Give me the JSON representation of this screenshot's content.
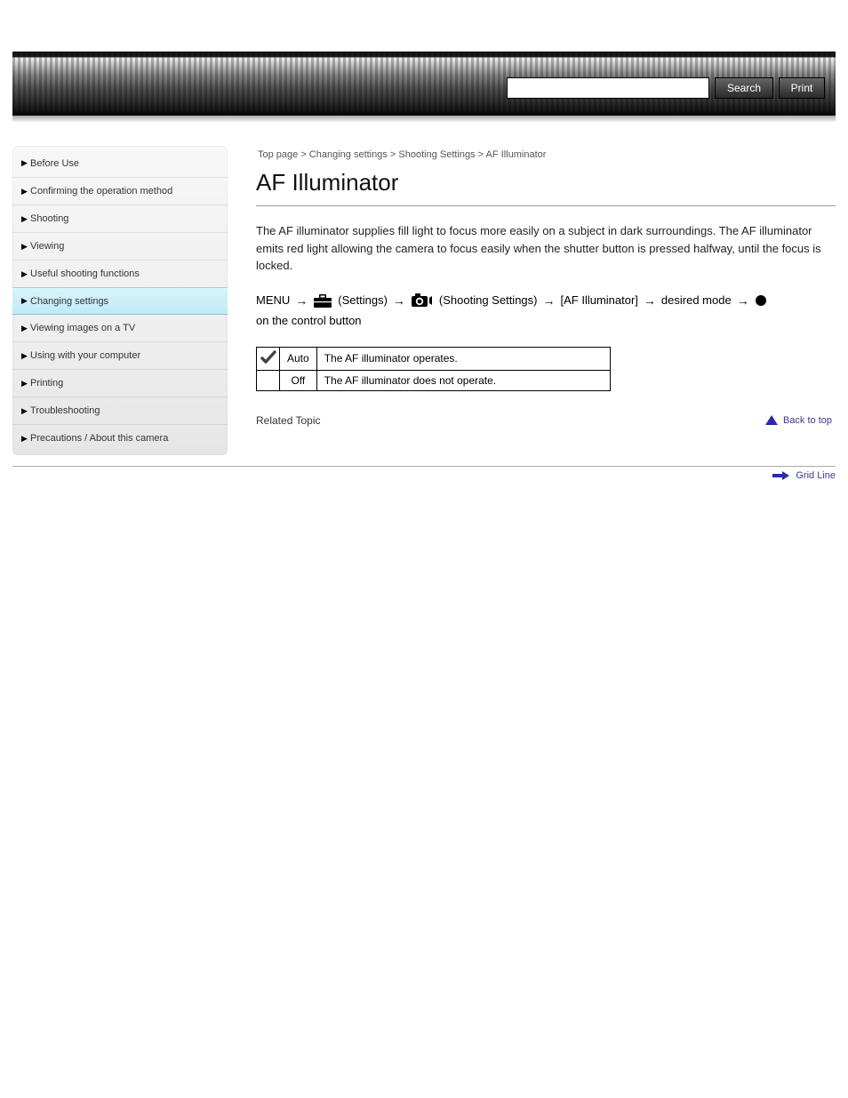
{
  "header": {
    "search_button": "Search",
    "print_button": "Print"
  },
  "sidebar": {
    "items": [
      {
        "label": "Before Use",
        "active": false
      },
      {
        "label": "Confirming the operation method",
        "active": false
      },
      {
        "label": "Shooting",
        "active": false
      },
      {
        "label": "Viewing",
        "active": false
      },
      {
        "label": "Useful shooting functions",
        "active": false
      },
      {
        "label": "Changing settings",
        "active": true
      },
      {
        "label": "Viewing images on a TV",
        "active": false
      },
      {
        "label": "Using with your computer",
        "active": false
      },
      {
        "label": "Printing",
        "active": false
      },
      {
        "label": "Troubleshooting",
        "active": false
      },
      {
        "label": "Precautions / About this camera",
        "active": false
      }
    ]
  },
  "breadcrumb": "Top page > Changing settings > Shooting Settings > AF Illuminator",
  "title": "AF Illuminator",
  "intro": "The AF illuminator supplies fill light to focus more easily on a subject in dark surroundings. The AF illuminator emits red light allowing the camera to focus easily when the shutter button is pressed halfway, until the focus is locked.",
  "path": {
    "step1": "MENU",
    "step2_label": "(Settings)",
    "step3_label": "(Shooting Settings)",
    "step4": "[AF Illuminator]",
    "step5": "desired mode",
    "step6_trailer": "on the control button"
  },
  "table": {
    "rows": [
      {
        "check": true,
        "label": "Auto",
        "desc": "The AF illuminator operates."
      },
      {
        "check": false,
        "label": "Off",
        "desc": "The AF illuminator does not operate."
      }
    ]
  },
  "related": "Related Topic",
  "back_to_top": "Back to top",
  "bottom_nav": {
    "next": "Grid Line"
  }
}
